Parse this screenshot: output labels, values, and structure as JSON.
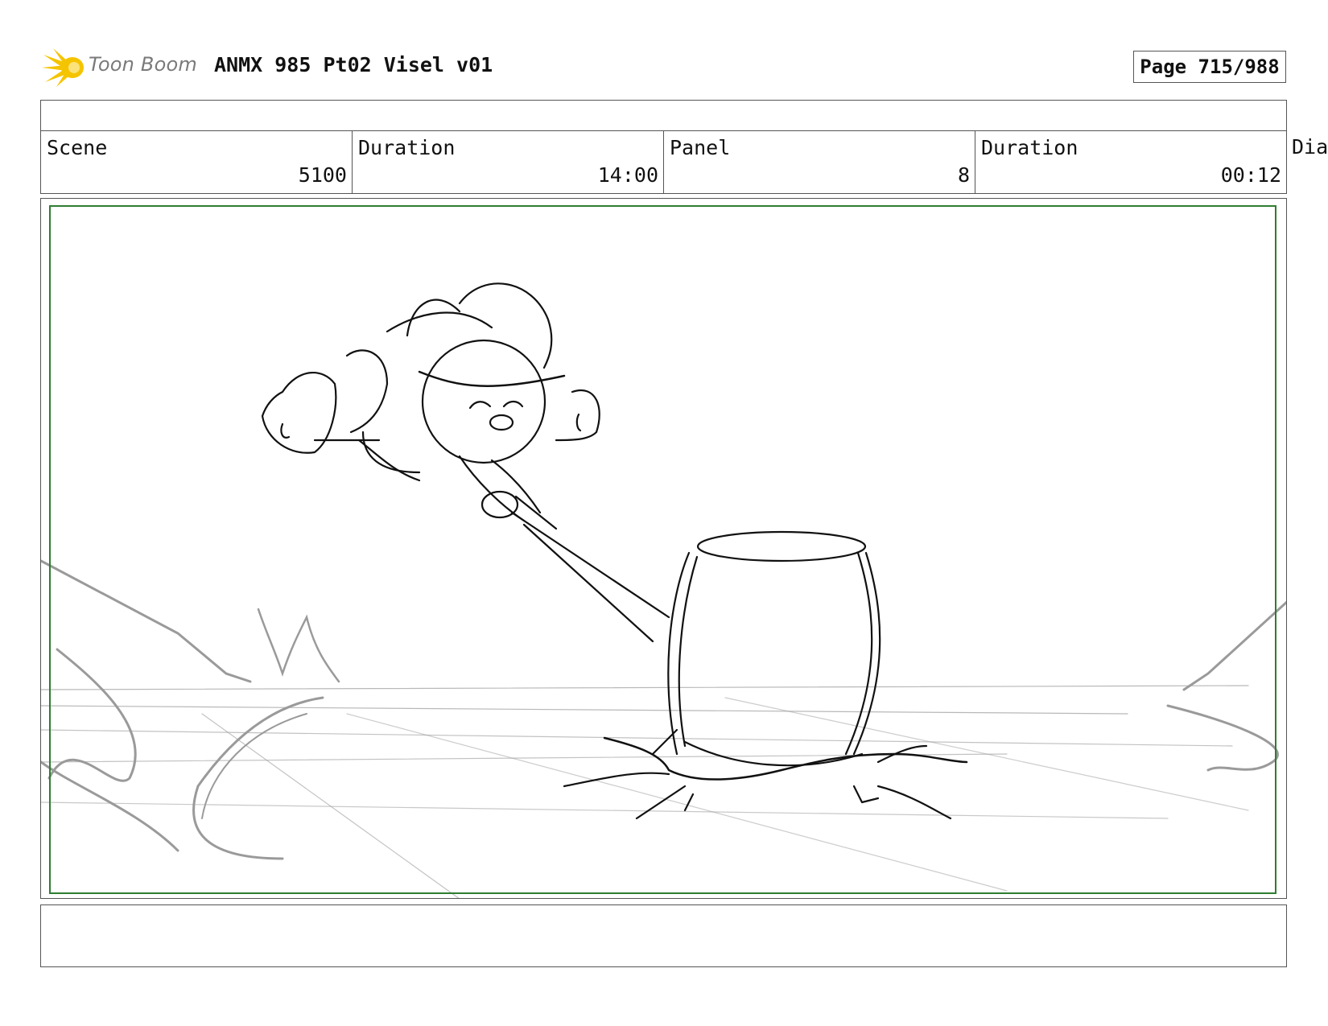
{
  "header": {
    "logo_text": "Toon Boom",
    "project_title": "ANMX 985 Pt02 Visel v01",
    "page_label": "Page 715/988"
  },
  "info": {
    "scene_label": "Scene",
    "scene_value": "5100",
    "scene_duration_label": "Duration",
    "scene_duration_value": "14:00",
    "panel_label": "Panel",
    "panel_value": "8",
    "panel_duration_label": "Duration",
    "panel_duration_value": "00:12",
    "dialogue_label": "Dia"
  },
  "colors": {
    "safe_frame": "#2e7d32",
    "logo_star": "#f5c400",
    "sketch_ink": "#111111",
    "sketch_background": "#9a9a9a"
  },
  "panel": {
    "icon": "storyboard-sketch-character-hammer"
  }
}
